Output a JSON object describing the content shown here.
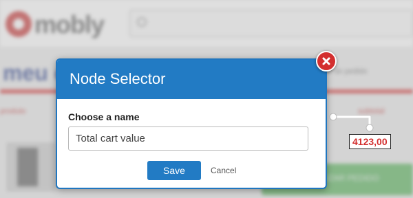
{
  "background": {
    "logo_text": "mobly",
    "search_placeholder": "",
    "title": "meu c",
    "order_text": "ho do pedido",
    "products_label": "produto",
    "right_label": "subtotal",
    "green_button_label": "FINALIZAR PEDIDO"
  },
  "modal": {
    "title": "Node Selector",
    "field_label": "Choose a name",
    "field_value": "Total cart value",
    "save_label": "Save",
    "cancel_label": "Cancel"
  },
  "selected_value": "4123,00",
  "colors": {
    "accent": "#227bc4",
    "close": "#d32f2f",
    "value_text": "#d32f2f"
  }
}
